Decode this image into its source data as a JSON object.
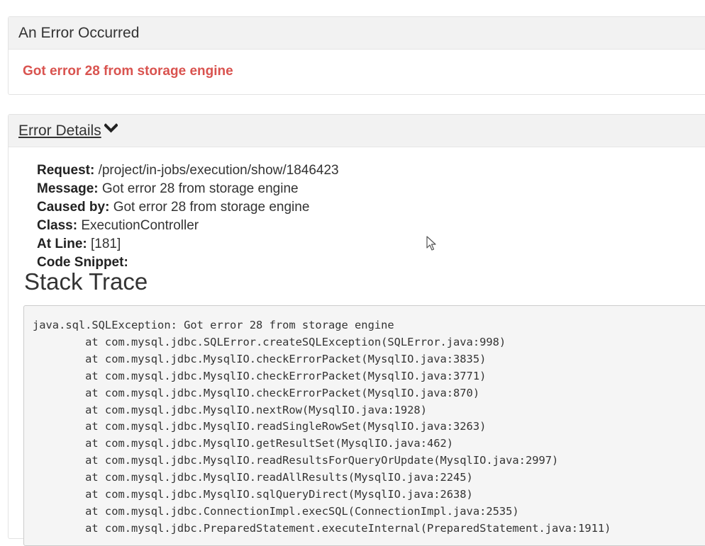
{
  "error_panel": {
    "title": "An Error Occurred",
    "message": "Got error 28 from storage engine"
  },
  "details_panel": {
    "toggle_label": "Error Details",
    "toggle_icon": "chevron-down-icon",
    "fields": [
      {
        "key": "Request:",
        "value": "/project/in-jobs/execution/show/1846423"
      },
      {
        "key": "Message:",
        "value": "Got error 28 from storage engine"
      },
      {
        "key": "Caused by:",
        "value": "Got error 28 from storage engine"
      },
      {
        "key": "Class:",
        "value": "ExecutionController"
      },
      {
        "key": "At Line:",
        "value": "[181]"
      },
      {
        "key": "Code Snippet:",
        "value": ""
      }
    ],
    "stack_title": "Stack Trace",
    "stack_lines": [
      "java.sql.SQLException: Got error 28 from storage engine",
      "        at com.mysql.jdbc.SQLError.createSQLException(SQLError.java:998)",
      "        at com.mysql.jdbc.MysqlIO.checkErrorPacket(MysqlIO.java:3835)",
      "        at com.mysql.jdbc.MysqlIO.checkErrorPacket(MysqlIO.java:3771)",
      "        at com.mysql.jdbc.MysqlIO.checkErrorPacket(MysqlIO.java:870)",
      "        at com.mysql.jdbc.MysqlIO.nextRow(MysqlIO.java:1928)",
      "        at com.mysql.jdbc.MysqlIO.readSingleRowSet(MysqlIO.java:3263)",
      "        at com.mysql.jdbc.MysqlIO.getResultSet(MysqlIO.java:462)",
      "        at com.mysql.jdbc.MysqlIO.readResultsForQueryOrUpdate(MysqlIO.java:2997)",
      "        at com.mysql.jdbc.MysqlIO.readAllResults(MysqlIO.java:2245)",
      "        at com.mysql.jdbc.MysqlIO.sqlQueryDirect(MysqlIO.java:2638)",
      "        at com.mysql.jdbc.ConnectionImpl.execSQL(ConnectionImpl.java:2535)",
      "        at com.mysql.jdbc.PreparedStatement.executeInternal(PreparedStatement.java:1911)"
    ]
  },
  "colors": {
    "error_text": "#d9534f",
    "heading_bg": "#f2f2f2",
    "code_bg": "#f5f5f5"
  }
}
